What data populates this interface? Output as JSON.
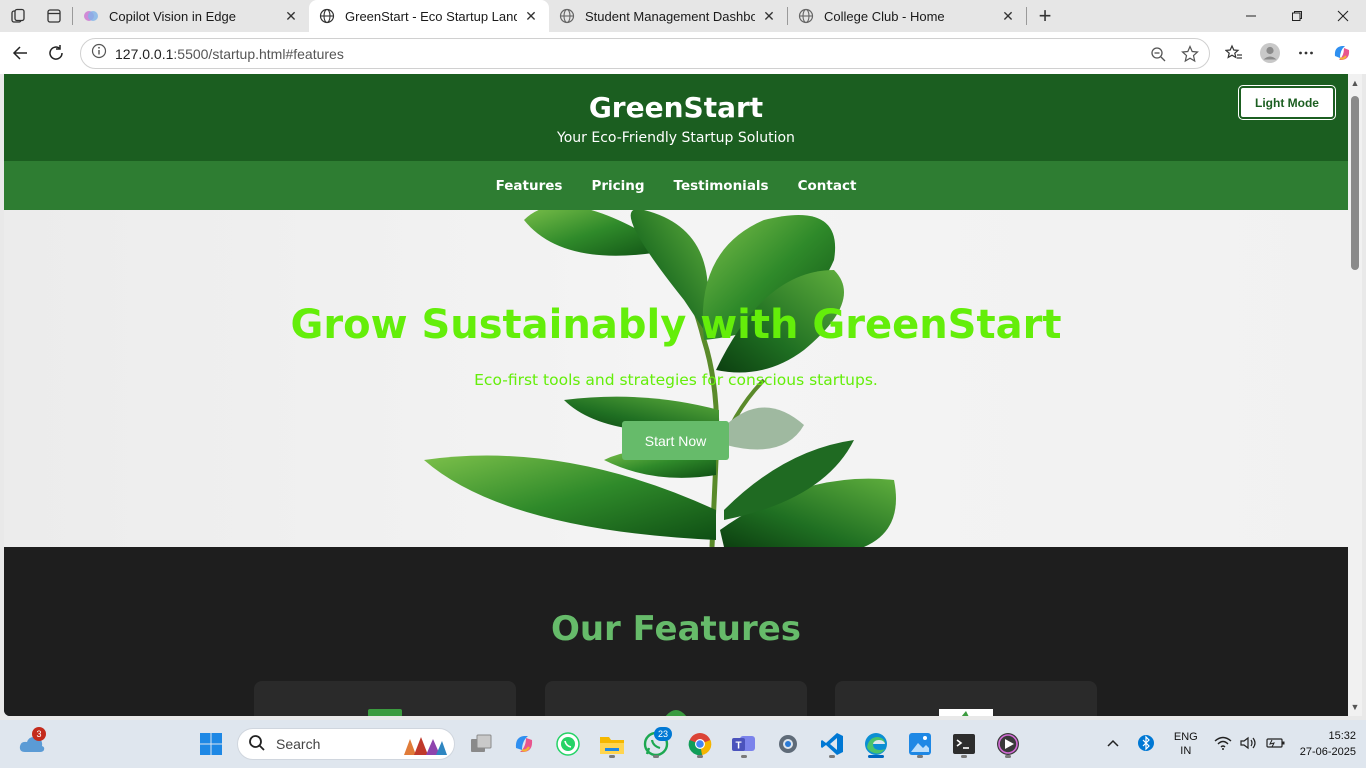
{
  "browser": {
    "tabs": [
      {
        "title": "Copilot Vision in Edge",
        "active": false
      },
      {
        "title": "GreenStart - Eco Startup Landing",
        "active": true
      },
      {
        "title": "Student Management Dashboard",
        "active": false
      },
      {
        "title": "College Club - Home",
        "active": false
      }
    ],
    "address": {
      "host": "127.0.0.1",
      "path": ":5500/startup.html#features"
    }
  },
  "site": {
    "brand": "GreenStart",
    "tagline": "Your Eco-Friendly Startup Solution",
    "mode_button": "Light Mode",
    "nav": [
      "Features",
      "Pricing",
      "Testimonials",
      "Contact"
    ],
    "hero": {
      "headline": "Grow Sustainably with GreenStart",
      "subtext": "Eco-first tools and strategies for conscious startups.",
      "cta": "Start Now"
    },
    "features_title": "Our Features"
  },
  "taskbar": {
    "search_placeholder": "Search",
    "weather_badge": "3",
    "whatsapp_badge": "23",
    "lang_top": "ENG",
    "lang_bottom": "IN",
    "time": "15:32",
    "date": "27-06-2025"
  },
  "colors": {
    "header": "#1b5e20",
    "nav": "#2e7d32",
    "hero_text": "#64ee0a",
    "accent": "#66bb6a",
    "dark_bg": "#1e1e1e"
  }
}
